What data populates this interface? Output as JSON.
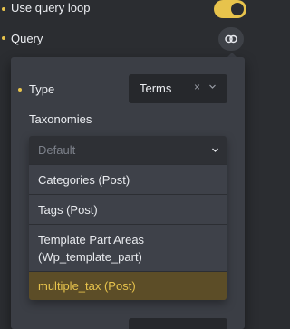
{
  "loop": {
    "label": "Use query loop",
    "enabled": true
  },
  "query": {
    "label": "Query",
    "icon": "link-icon"
  },
  "type_field": {
    "label": "Type",
    "value": "Terms",
    "clear": "×"
  },
  "taxonomies": {
    "label": "Taxonomies",
    "placeholder": "Default",
    "options": [
      "Categories (Post)",
      "Tags (Post)",
      "Template Part Areas (Wp_template_part)",
      "multiple_tax (Post)"
    ],
    "highlighted_index": 3
  },
  "colors": {
    "accent": "#e7c34c",
    "background": "#2b2d31",
    "panel": "#3b3e45"
  }
}
